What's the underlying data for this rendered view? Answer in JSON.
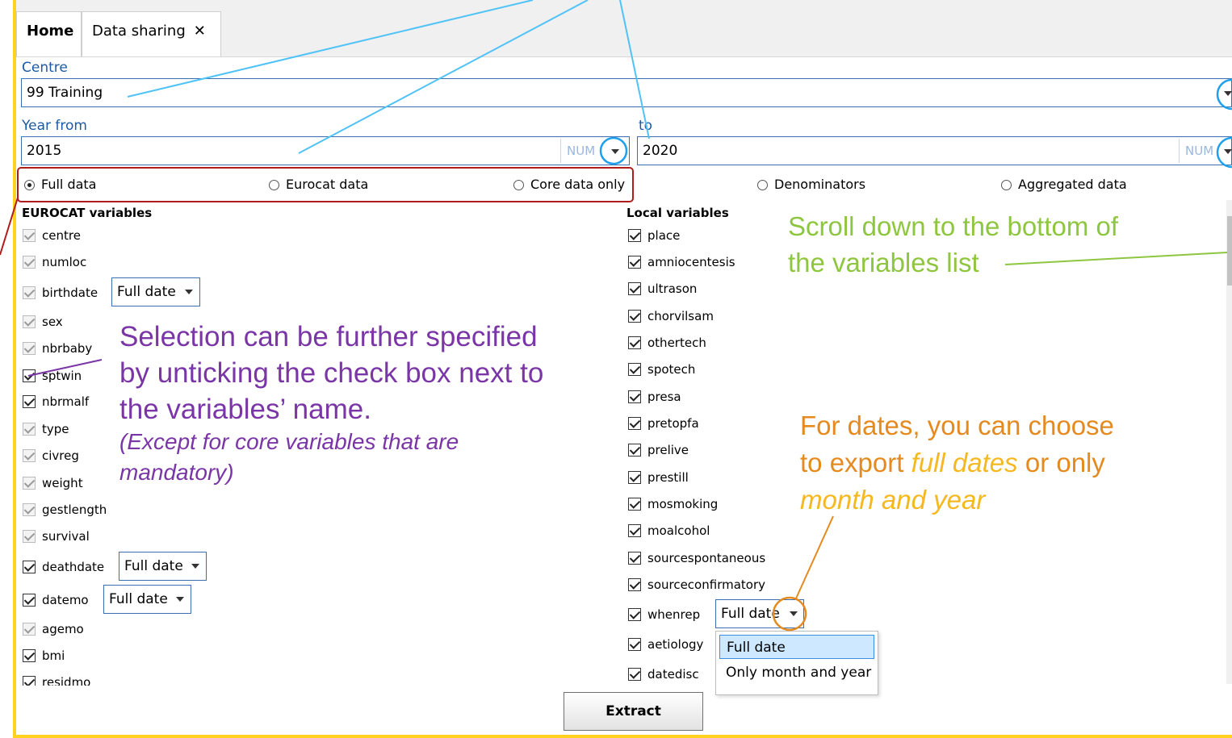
{
  "tabs": {
    "home": "Home",
    "data_sharing": "Data sharing",
    "close": "✕"
  },
  "centre": {
    "label": "Centre",
    "value": "99 Training"
  },
  "year_from": {
    "label": "Year from",
    "value": "2015",
    "num": "NUM"
  },
  "year_to": {
    "label": "to",
    "value": "2020",
    "num": "NUM"
  },
  "radios": [
    {
      "label": "Full data",
      "selected": true
    },
    {
      "label": "Eurocat data",
      "selected": false
    },
    {
      "label": "Core data only",
      "selected": false
    },
    {
      "label": "Denominators",
      "selected": false
    },
    {
      "label": "Aggregated data",
      "selected": false
    }
  ],
  "eurocat": {
    "title": "EUROCAT variables",
    "items": [
      {
        "name": "centre",
        "checked": true,
        "enabled": false
      },
      {
        "name": "numloc",
        "checked": true,
        "enabled": false
      },
      {
        "name": "birthdate",
        "checked": true,
        "enabled": false,
        "date": "Full date"
      },
      {
        "name": "sex",
        "checked": true,
        "enabled": false
      },
      {
        "name": "nbrbaby",
        "checked": true,
        "enabled": false
      },
      {
        "name": "sptwin",
        "checked": true,
        "enabled": true
      },
      {
        "name": "nbrmalf",
        "checked": true,
        "enabled": true
      },
      {
        "name": "type",
        "checked": true,
        "enabled": false
      },
      {
        "name": "civreg",
        "checked": true,
        "enabled": false
      },
      {
        "name": "weight",
        "checked": true,
        "enabled": false
      },
      {
        "name": "gestlength",
        "checked": true,
        "enabled": false
      },
      {
        "name": "survival",
        "checked": true,
        "enabled": false
      },
      {
        "name": "deathdate",
        "checked": true,
        "enabled": true,
        "date": "Full date"
      },
      {
        "name": "datemo",
        "checked": true,
        "enabled": true,
        "date": "Full date"
      },
      {
        "name": "agemo",
        "checked": true,
        "enabled": false
      },
      {
        "name": "bmi",
        "checked": true,
        "enabled": true
      },
      {
        "name": "residmo",
        "checked": true,
        "enabled": true
      }
    ]
  },
  "local": {
    "title": "Local variables",
    "items": [
      {
        "name": "place"
      },
      {
        "name": "amniocentesis"
      },
      {
        "name": "ultrason"
      },
      {
        "name": "chorvilsam"
      },
      {
        "name": "othertech"
      },
      {
        "name": "spotech"
      },
      {
        "name": "presa"
      },
      {
        "name": "pretopfa"
      },
      {
        "name": "prelive"
      },
      {
        "name": "prestill"
      },
      {
        "name": "mosmoking"
      },
      {
        "name": "moalcohol"
      },
      {
        "name": "sourcespontaneous"
      },
      {
        "name": "sourceconfirmatory"
      },
      {
        "name": "whenrep",
        "date": "Full date"
      },
      {
        "name": "aetiology"
      },
      {
        "name": "datedisc"
      }
    ]
  },
  "date_menu": {
    "options": [
      "Full date",
      "Only month and year"
    ],
    "selected": "Full date"
  },
  "extract": "Extract",
  "annotations": {
    "green": [
      "Scroll down to the bottom of",
      "the variables list"
    ],
    "purple": [
      "Selection can be further specified",
      "by unticking the check box next to",
      "the variables’ name."
    ],
    "purple_italic": [
      "(Except for core variables that are",
      "mandatory)"
    ],
    "orange_1": "For dates, you can choose",
    "orange_2a": "to export ",
    "orange_2b": "full dates",
    "orange_2c": " or only",
    "orange_3": "month and year"
  },
  "colors": {
    "frame": "#ffd21f",
    "blue_line": "#4fc3f7",
    "green": "#8ec63f",
    "purple": "#7a35a6",
    "orange": "#e58a1f",
    "red_box": "#b01c1c"
  }
}
